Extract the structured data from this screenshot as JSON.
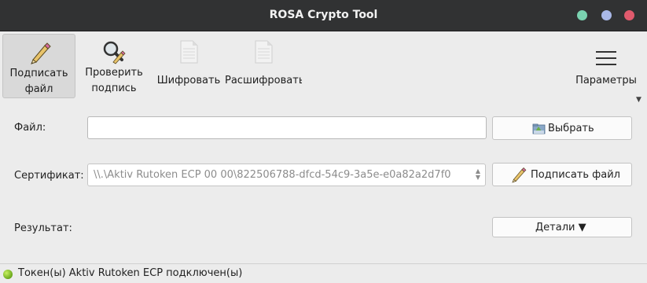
{
  "window": {
    "title": "ROSA Crypto Tool",
    "controls": {
      "minimize_color": "#7ad2b0",
      "maximize_color": "#a9b8e8",
      "close_color": "#e05a6d"
    }
  },
  "toolbar": {
    "sign": {
      "label": "Подписать\nфайл",
      "icon": "pen-icon"
    },
    "verify": {
      "label": "Проверить\nподпись",
      "icon": "magnifier-icon"
    },
    "encrypt": {
      "label": "Шифровать",
      "icon": "document-icon"
    },
    "decrypt": {
      "label": "Расшифровать",
      "icon": "document-icon"
    },
    "params": {
      "label": "Параметры",
      "icon": "hamburger-menu-icon"
    }
  },
  "form": {
    "file_label": "Файл:",
    "file_value": "",
    "choose_button": "Выбрать",
    "cert_label": "Сертификат:",
    "cert_value": "\\\\.\\Aktiv Rutoken ECP 00 00\\822506788-dfcd-54c9-3a5e-e0a82a2d7f0",
    "sign_button": "Подписать файл",
    "result_label": "Результат:",
    "details_button": "Детали ▼"
  },
  "status": {
    "text": "Токен(ы) Aktiv Rutoken ECP подключен(ы)",
    "indicator_color": "#6aa81c"
  }
}
